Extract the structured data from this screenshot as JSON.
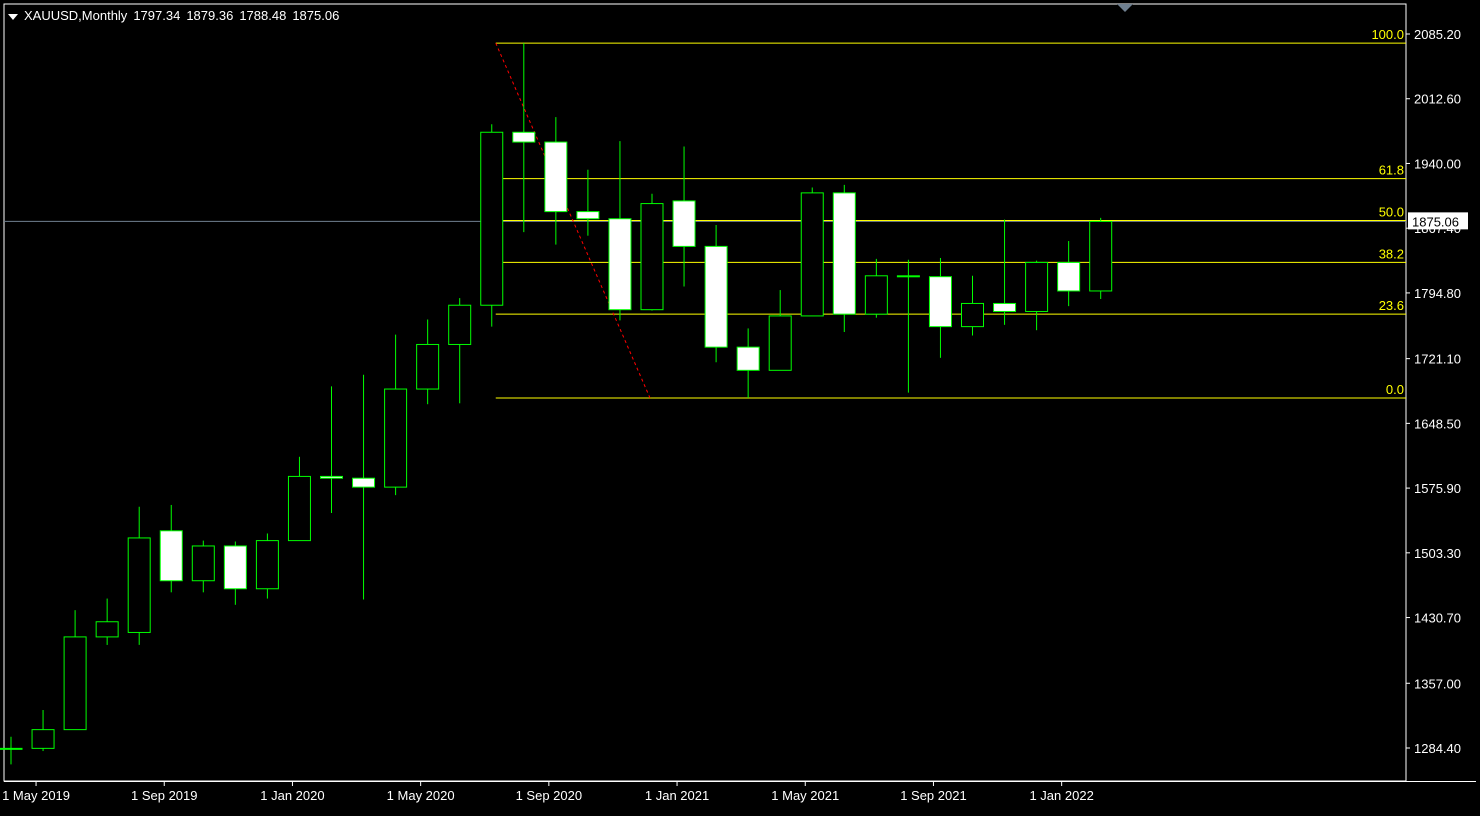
{
  "header": {
    "symbol": "XAUUSD,Monthly",
    "open": "1797.34",
    "high": "1879.36",
    "low": "1788.48",
    "close": "1875.06"
  },
  "colors": {
    "background": "#000000",
    "candle_outline": "#00ff00",
    "bull_fill": "#000000",
    "bear_fill": "#ffffff",
    "fib_line": "#ffff00",
    "fib_trend": "#ff0000",
    "price_line": "#708090",
    "axis_text": "#ffffff"
  },
  "chart_data": {
    "type": "candlestick",
    "symbol": "XAUUSD",
    "timeframe": "Monthly",
    "grid": false,
    "ylim": [
      1245,
      2120
    ],
    "y_ticks": [
      "2085.20",
      "2012.60",
      "1940.00",
      "1867.40",
      "1794.80",
      "1721.10",
      "1648.50",
      "1575.90",
      "1503.30",
      "1430.70",
      "1357.00",
      "1284.40"
    ],
    "x_ticks": [
      "1 May 2019",
      "1 Sep 2019",
      "1 Jan 2020",
      "1 May 2020",
      "1 Sep 2020",
      "1 Jan 2021",
      "1 May 2021",
      "1 Sep 2021",
      "1 Jan 2022"
    ],
    "current_price": "1875.06",
    "candles": [
      {
        "date": "2019-04",
        "o": 1283,
        "h": 1297,
        "l": 1266,
        "c": 1284
      },
      {
        "date": "2019-05",
        "o": 1284,
        "h": 1327,
        "l": 1281,
        "c": 1305
      },
      {
        "date": "2019-06",
        "o": 1305,
        "h": 1439,
        "l": 1305,
        "c": 1409
      },
      {
        "date": "2019-07",
        "o": 1409,
        "h": 1452,
        "l": 1400,
        "c": 1426
      },
      {
        "date": "2019-08",
        "o": 1414,
        "h": 1555,
        "l": 1400,
        "c": 1520
      },
      {
        "date": "2019-09",
        "o": 1528,
        "h": 1557,
        "l": 1459,
        "c": 1472
      },
      {
        "date": "2019-10",
        "o": 1472,
        "h": 1517,
        "l": 1459,
        "c": 1511
      },
      {
        "date": "2019-11",
        "o": 1511,
        "h": 1516,
        "l": 1445,
        "c": 1463
      },
      {
        "date": "2019-12",
        "o": 1463,
        "h": 1525,
        "l": 1452,
        "c": 1517
      },
      {
        "date": "2020-01",
        "o": 1517,
        "h": 1611,
        "l": 1517,
        "c": 1589
      },
      {
        "date": "2020-02",
        "o": 1589,
        "h": 1690,
        "l": 1548,
        "c": 1587
      },
      {
        "date": "2020-03",
        "o": 1587,
        "h": 1703,
        "l": 1451,
        "c": 1577
      },
      {
        "date": "2020-04",
        "o": 1577,
        "h": 1748,
        "l": 1568,
        "c": 1687
      },
      {
        "date": "2020-05",
        "o": 1687,
        "h": 1765,
        "l": 1670,
        "c": 1737
      },
      {
        "date": "2020-06",
        "o": 1737,
        "h": 1789,
        "l": 1671,
        "c": 1781
      },
      {
        "date": "2020-07",
        "o": 1781,
        "h": 1984,
        "l": 1757,
        "c": 1975
      },
      {
        "date": "2020-08",
        "o": 1975,
        "h": 2075,
        "l": 1863,
        "c": 1964
      },
      {
        "date": "2020-09",
        "o": 1964,
        "h": 1992,
        "l": 1849,
        "c": 1886
      },
      {
        "date": "2020-10",
        "o": 1886,
        "h": 1933,
        "l": 1859,
        "c": 1878
      },
      {
        "date": "2020-11",
        "o": 1878,
        "h": 1965,
        "l": 1764,
        "c": 1776
      },
      {
        "date": "2020-12",
        "o": 1776,
        "h": 1906,
        "l": 1775,
        "c": 1895
      },
      {
        "date": "2021-01",
        "o": 1898,
        "h": 1959,
        "l": 1802,
        "c": 1847
      },
      {
        "date": "2021-02",
        "o": 1847,
        "h": 1871,
        "l": 1717,
        "c": 1734
      },
      {
        "date": "2021-03",
        "o": 1734,
        "h": 1755,
        "l": 1677,
        "c": 1708
      },
      {
        "date": "2021-04",
        "o": 1708,
        "h": 1798,
        "l": 1708,
        "c": 1769
      },
      {
        "date": "2021-05",
        "o": 1769,
        "h": 1913,
        "l": 1769,
        "c": 1907
      },
      {
        "date": "2021-06",
        "o": 1907,
        "h": 1916,
        "l": 1751,
        "c": 1771
      },
      {
        "date": "2021-07",
        "o": 1771,
        "h": 1833,
        "l": 1767,
        "c": 1814
      },
      {
        "date": "2021-08",
        "o": 1814,
        "h": 1832,
        "l": 1683,
        "c": 1814
      },
      {
        "date": "2021-09",
        "o": 1813,
        "h": 1834,
        "l": 1722,
        "c": 1757
      },
      {
        "date": "2021-10",
        "o": 1757,
        "h": 1814,
        "l": 1747,
        "c": 1783
      },
      {
        "date": "2021-11",
        "o": 1783,
        "h": 1877,
        "l": 1759,
        "c": 1774
      },
      {
        "date": "2021-12",
        "o": 1774,
        "h": 1831,
        "l": 1753,
        "c": 1829
      },
      {
        "date": "2022-01",
        "o": 1829,
        "h": 1853,
        "l": 1780,
        "c": 1797
      },
      {
        "date": "2022-02",
        "o": 1797,
        "h": 1879,
        "l": 1788,
        "c": 1875
      }
    ],
    "fibonacci": {
      "high": 2075,
      "low": 1677,
      "levels": [
        {
          "label": "100.0",
          "price": 2075
        },
        {
          "label": "61.8",
          "price": 1923
        },
        {
          "label": "50.0",
          "price": 1876
        },
        {
          "label": "38.2",
          "price": 1829
        },
        {
          "label": "23.6",
          "price": 1771
        },
        {
          "label": "0.0",
          "price": 1677
        }
      ]
    }
  }
}
